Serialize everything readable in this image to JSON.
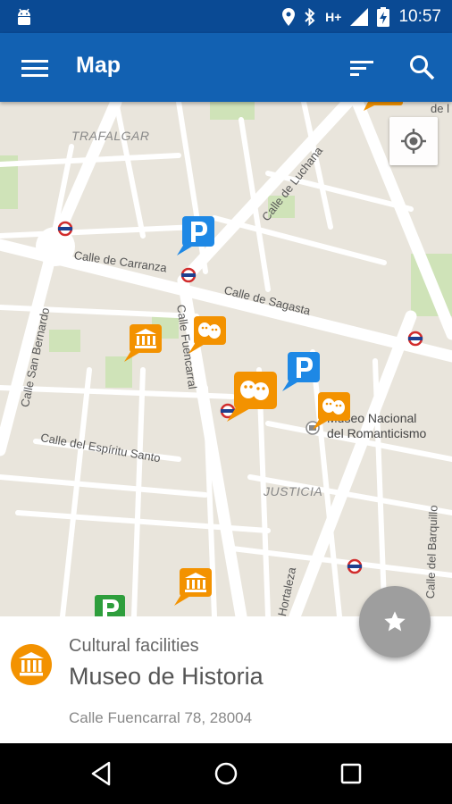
{
  "status_bar": {
    "network": "H+",
    "time": "10:57",
    "icons": [
      "android-icon",
      "location-icon",
      "bluetooth-icon",
      "signal-icon",
      "battery-charging-icon"
    ]
  },
  "app_bar": {
    "title": "Map",
    "icons": [
      "menu-icon",
      "sort-icon",
      "search-icon"
    ],
    "color": "#1261b2"
  },
  "map": {
    "districts": [
      "TRAFALGAR",
      "JUSTICIA"
    ],
    "streets": [
      "Calle de Carranza",
      "Calle de Sagasta",
      "Calle de Luchana",
      "Calle San Bernardo",
      "Calle Fuencarral",
      "Calle del Espíritu Santo",
      "Calle del Barquillo",
      "Hortaleza"
    ],
    "edge_text": "de l",
    "places": {
      "museum_line1": "Museo Nacional",
      "museum_line2": "del Romanticismo"
    },
    "markers": [
      {
        "type": "parking",
        "color": "#1e88e5"
      },
      {
        "type": "theatre",
        "color": "#f39200"
      },
      {
        "type": "museum",
        "color": "#f39200"
      },
      {
        "type": "theatre",
        "color": "#f39200"
      },
      {
        "type": "parking",
        "color": "#1e88e5"
      },
      {
        "type": "theatre",
        "color": "#f39200"
      },
      {
        "type": "museum",
        "color": "#f39200"
      },
      {
        "type": "parking",
        "color": "#2e9e3c"
      }
    ]
  },
  "fab": {
    "icon": "star-icon",
    "color": "#9e9e9e"
  },
  "info_card": {
    "category": "Cultural facilities",
    "name": "Museo de Historia",
    "address": "Calle Fuencarral 78, 28004",
    "icon": "museum-icon",
    "icon_color": "#f39200"
  },
  "nav_bar": {
    "icons": [
      "back-icon",
      "home-icon",
      "recents-icon"
    ]
  }
}
